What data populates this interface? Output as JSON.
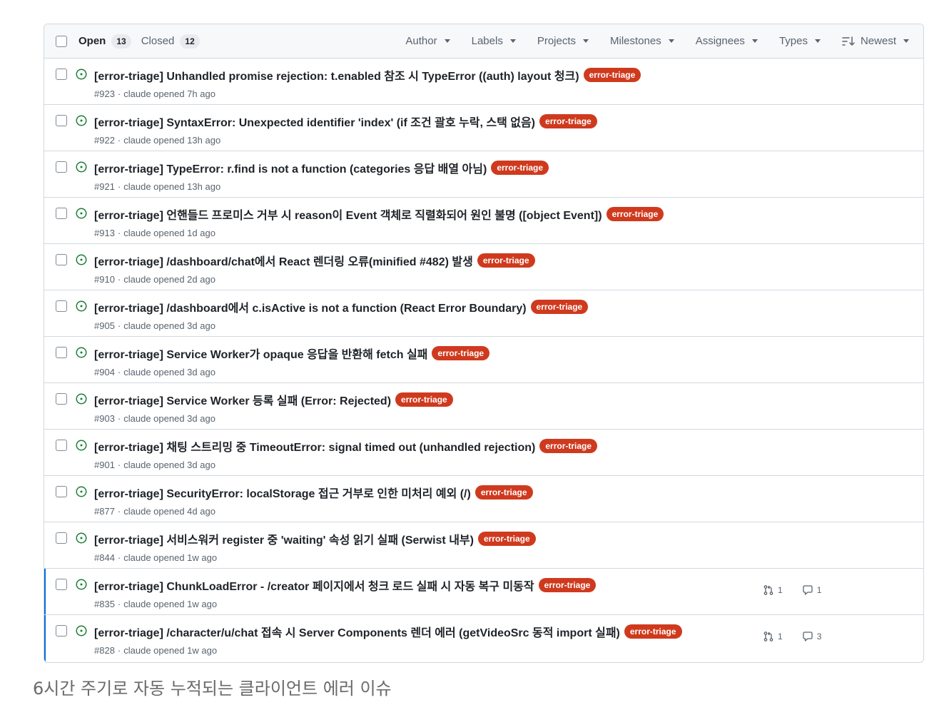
{
  "header": {
    "open_label": "Open",
    "open_count": "13",
    "closed_label": "Closed",
    "closed_count": "12",
    "filters": [
      "Author",
      "Labels",
      "Projects",
      "Milestones",
      "Assignees",
      "Types"
    ],
    "sort_label": "Newest"
  },
  "label_color": "#cf3a1e",
  "open_icon_color": "#1a7f37",
  "issues": [
    {
      "title": "[error-triage] Unhandled promise rejection: t.enabled 참조 시 TypeError ((auth) layout 청크)",
      "label": "error-triage",
      "number": "#923",
      "meta": "claude opened 7h ago"
    },
    {
      "title": "[error-triage] SyntaxError: Unexpected identifier 'index' (if 조건 괄호 누락, 스택 없음)",
      "label": "error-triage",
      "number": "#922",
      "meta": "claude opened 13h ago"
    },
    {
      "title": "[error-triage] TypeError: r.find is not a function (categories 응답 배열 아님)",
      "label": "error-triage",
      "number": "#921",
      "meta": "claude opened 13h ago"
    },
    {
      "title": "[error-triage] 언핸들드 프로미스 거부 시 reason이 Event 객체로 직렬화되어 원인 불명 ([object Event])",
      "label": "error-triage",
      "number": "#913",
      "meta": "claude opened 1d ago"
    },
    {
      "title": "[error-triage] /dashboard/chat에서 React 렌더링 오류(minified #482) 발생",
      "label": "error-triage",
      "number": "#910",
      "meta": "claude opened 2d ago"
    },
    {
      "title": "[error-triage] /dashboard에서 c.isActive is not a function (React Error Boundary)",
      "label": "error-triage",
      "number": "#905",
      "meta": "claude opened 3d ago"
    },
    {
      "title": "[error-triage] Service Worker가 opaque 응답을 반환해 fetch 실패",
      "label": "error-triage",
      "number": "#904",
      "meta": "claude opened 3d ago"
    },
    {
      "title": "[error-triage] Service Worker 등록 실패 (Error: Rejected)",
      "label": "error-triage",
      "number": "#903",
      "meta": "claude opened 3d ago"
    },
    {
      "title": "[error-triage] 채팅 스트리밍 중 TimeoutError: signal timed out (unhandled rejection)",
      "label": "error-triage",
      "number": "#901",
      "meta": "claude opened 3d ago"
    },
    {
      "title": "[error-triage] SecurityError: localStorage 접근 거부로 인한 미처리 예외 (/)",
      "label": "error-triage",
      "number": "#877",
      "meta": "claude opened 4d ago"
    },
    {
      "title": "[error-triage] 서비스워커 register 중 'waiting' 속성 읽기 실패 (Serwist 내부)",
      "label": "error-triage",
      "number": "#844",
      "meta": "claude opened 1w ago"
    },
    {
      "title": "[error-triage] ChunkLoadError - /creator 페이지에서 청크 로드 실패 시 자동 복구 미동작",
      "label": "error-triage",
      "number": "#835",
      "meta": "claude opened 1w ago",
      "prs": "1",
      "comments": "1"
    },
    {
      "title": "[error-triage] /character/u/chat 접속 시 Server Components 렌더 에러 (getVideoSrc 동적 import 실패)",
      "label": "error-triage",
      "number": "#828",
      "meta": "claude opened 1w ago",
      "prs": "1",
      "comments": "3"
    }
  ],
  "caption": "6시간 주기로 자동 누적되는 클라이언트 에러 이슈"
}
